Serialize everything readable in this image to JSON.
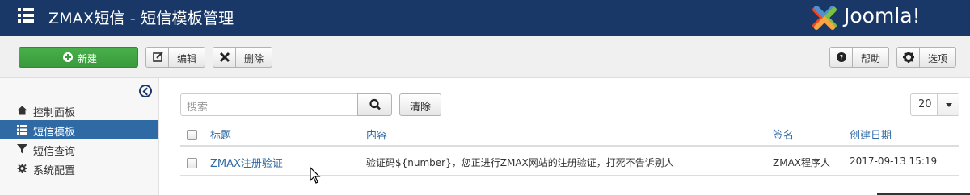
{
  "header": {
    "title": "ZMAX短信 - 短信模板管理",
    "logo_text": "Joomla!",
    "bg_color": "#1a3867"
  },
  "toolbar": {
    "new_label": "新建",
    "edit_label": "编辑",
    "delete_label": "删除",
    "help_label": "帮助",
    "options_label": "选项"
  },
  "sidebar": {
    "items": [
      {
        "label": "控制面板",
        "icon": "home-icon"
      },
      {
        "label": "短信模板",
        "icon": "list-icon",
        "active": true
      },
      {
        "label": "短信查询",
        "icon": "filter-icon"
      },
      {
        "label": "系统配置",
        "icon": "gear-icon"
      }
    ],
    "active_color": "#2f6aa5"
  },
  "filters": {
    "search_placeholder": "搜索",
    "clear_label": "清除",
    "limit_value": "20"
  },
  "table": {
    "columns": [
      "标题",
      "内容",
      "签名",
      "创建日期"
    ],
    "rows": [
      {
        "title": "ZMAX注册验证",
        "content": "验证码${number}，您正进行ZMAX网站的注册验证，打死不告诉别人",
        "signature": "ZMAX程序人",
        "created": "2017-09-13 15:19"
      }
    ]
  }
}
